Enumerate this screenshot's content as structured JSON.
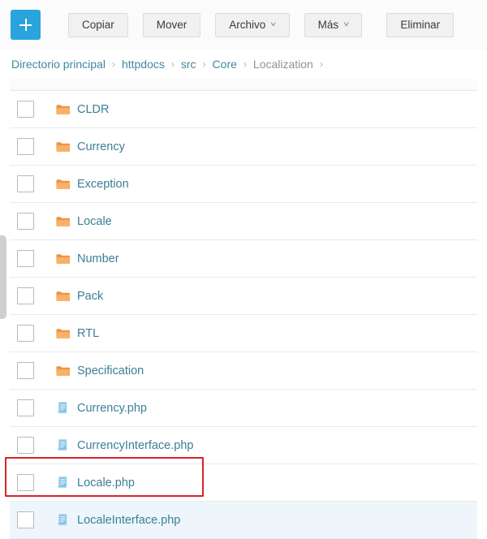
{
  "toolbar": {
    "add_button": {
      "label": "+",
      "icon": "plus-icon",
      "color": "#29a4dc"
    },
    "buttons": [
      {
        "label": "Copiar",
        "name": "copy-button",
        "dropdown": false
      },
      {
        "label": "Mover",
        "name": "move-button",
        "dropdown": false
      },
      {
        "label": "Archivo",
        "name": "file-menu-button",
        "dropdown": true,
        "caret": "˅"
      },
      {
        "label": "Más",
        "name": "more-menu-button",
        "dropdown": true,
        "caret": "˅"
      },
      {
        "label": "Eliminar",
        "name": "delete-button",
        "dropdown": false
      }
    ]
  },
  "breadcrumb": {
    "separator": "›",
    "items": [
      {
        "label": "Directorio principal",
        "current": false
      },
      {
        "label": "httpdocs",
        "current": false
      },
      {
        "label": "src",
        "current": false
      },
      {
        "label": "Core",
        "current": false
      },
      {
        "label": "Localization",
        "current": true
      }
    ]
  },
  "file_list": {
    "rows": [
      {
        "name": "CLDR",
        "type": "folder",
        "icon": "folder-icon",
        "checked": false,
        "hovered": false,
        "highlighted": false
      },
      {
        "name": "Currency",
        "type": "folder",
        "icon": "folder-icon",
        "checked": false,
        "hovered": false,
        "highlighted": false
      },
      {
        "name": "Exception",
        "type": "folder",
        "icon": "folder-icon",
        "checked": false,
        "hovered": false,
        "highlighted": false
      },
      {
        "name": "Locale",
        "type": "folder",
        "icon": "folder-icon",
        "checked": false,
        "hovered": false,
        "highlighted": false
      },
      {
        "name": "Number",
        "type": "folder",
        "icon": "folder-icon",
        "checked": false,
        "hovered": false,
        "highlighted": false
      },
      {
        "name": "Pack",
        "type": "folder",
        "icon": "folder-icon",
        "checked": false,
        "hovered": false,
        "highlighted": false
      },
      {
        "name": "RTL",
        "type": "folder",
        "icon": "folder-icon",
        "checked": false,
        "hovered": false,
        "highlighted": false
      },
      {
        "name": "Specification",
        "type": "folder",
        "icon": "folder-icon",
        "checked": false,
        "hovered": false,
        "highlighted": false
      },
      {
        "name": "Currency.php",
        "type": "file",
        "icon": "php-file-icon",
        "checked": false,
        "hovered": false,
        "highlighted": false
      },
      {
        "name": "CurrencyInterface.php",
        "type": "file",
        "icon": "php-file-icon",
        "checked": false,
        "hovered": false,
        "highlighted": false
      },
      {
        "name": "Locale.php",
        "type": "file",
        "icon": "php-file-icon",
        "checked": false,
        "hovered": false,
        "highlighted": true
      },
      {
        "name": "LocaleInterface.php",
        "type": "file",
        "icon": "php-file-icon",
        "checked": false,
        "hovered": true,
        "highlighted": false
      }
    ]
  },
  "colors": {
    "accent_blue": "#29a4dc",
    "link_teal": "#3a7f96",
    "folder_orange": "#f0953f",
    "file_blue": "#7cc0e4",
    "annotation_red": "#d8232a",
    "hover_row": "#eef6fb"
  },
  "scrollbar": {
    "name": "vertical-scrollbar",
    "orientation": "vertical"
  }
}
